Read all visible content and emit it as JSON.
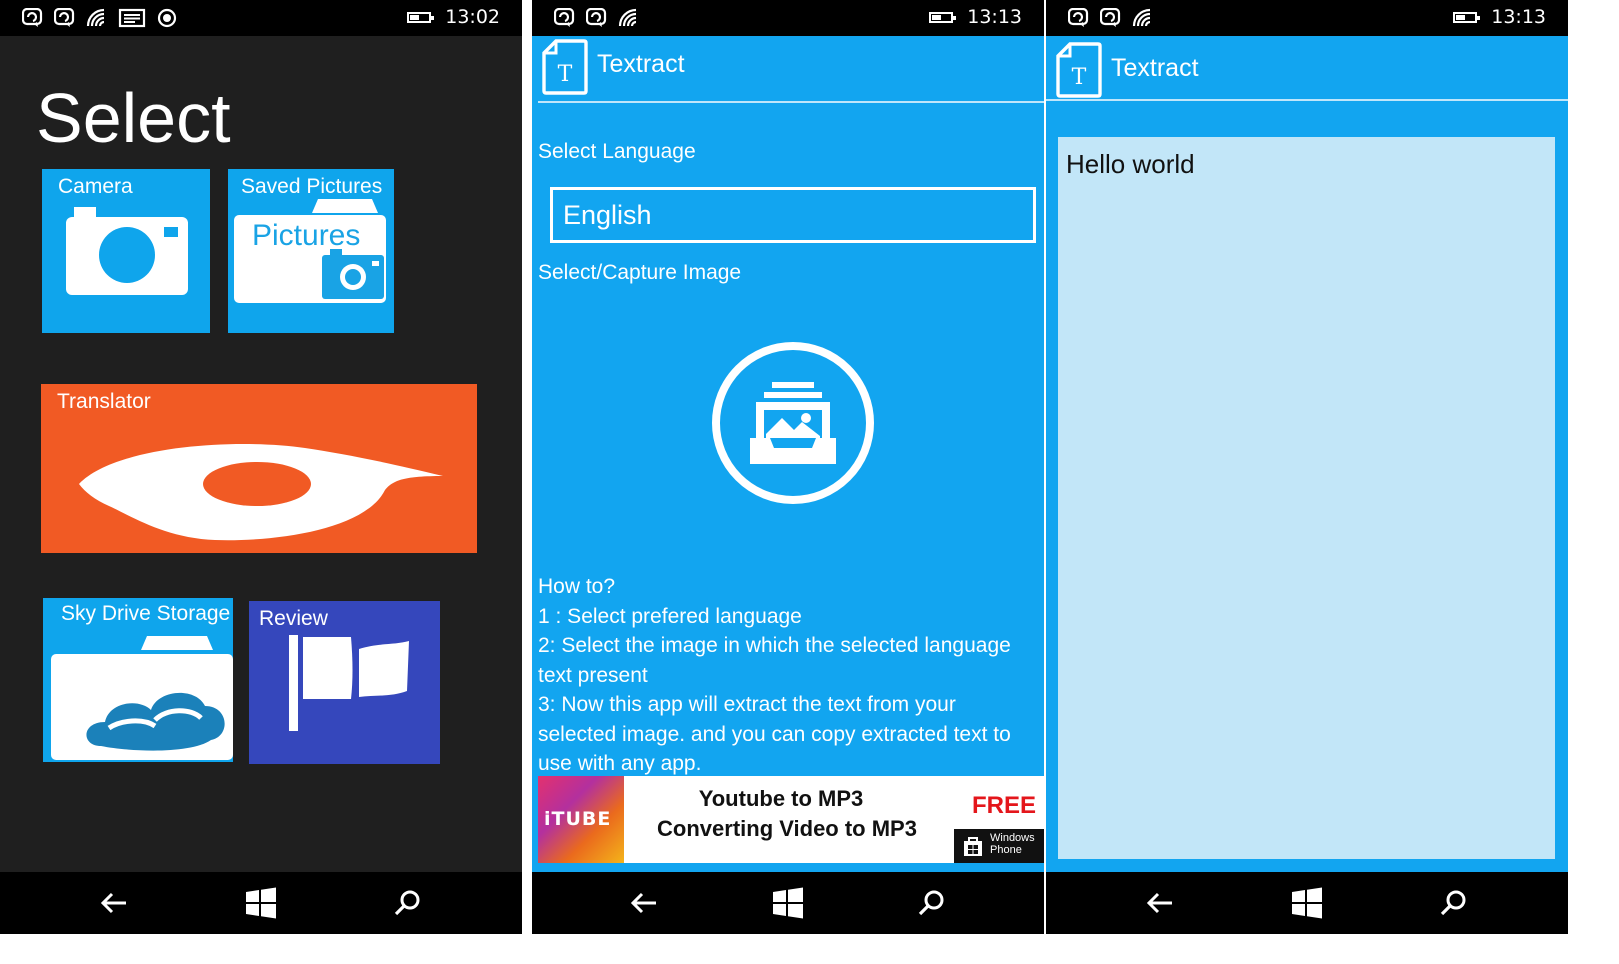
{
  "colors": {
    "accent": "#12a5f0",
    "tile_blue": "#0fa5ec",
    "tile_orange": "#f15a24",
    "tile_indigo": "#3547bc",
    "dark_bg": "#1f1f1f",
    "textbox_bg": "#c2e6f8",
    "ad_free": "#e4161b"
  },
  "screens": [
    {
      "status": {
        "time": "13:02",
        "icons": [
          "notification-icon",
          "notification-icon",
          "wifi-icon",
          "message-icon",
          "location-icon"
        ]
      },
      "title": "Select",
      "tiles": [
        {
          "label": "Camera",
          "icon": "camera-icon"
        },
        {
          "label": "Saved Pictures",
          "icon": "pictures-icon",
          "inner_text": "Pictures"
        },
        {
          "label": "Translator",
          "icon": "translator-icon"
        },
        {
          "label": "Sky Drive Storage",
          "icon": "skydrive-icon"
        },
        {
          "label": "Review",
          "icon": "flag-icon"
        }
      ]
    },
    {
      "status": {
        "time": "13:13",
        "icons": [
          "notification-icon",
          "notification-icon",
          "wifi-icon"
        ]
      },
      "app_name": "Textract",
      "select_language_label": "Select Language",
      "language_value": "English",
      "select_image_label": "Select/Capture Image",
      "howto": [
        "How to?",
        "1 : Select prefered language",
        "2: Select the image in which the selected language text present",
        "3: Now this app will extract the text from your selected image. and you can copy extracted text to use with any app."
      ],
      "ad": {
        "brand": "iTUBE",
        "line1": "Youtube to MP3",
        "line2": "Converting Video to MP3",
        "free": "FREE",
        "store_line1": "Windows",
        "store_line2": "Phone"
      }
    },
    {
      "status": {
        "time": "13:13",
        "icons": [
          "notification-icon",
          "notification-icon",
          "wifi-icon"
        ]
      },
      "app_name": "Textract",
      "extracted_text": "Hello world"
    }
  ],
  "nav_icons": [
    "back-icon",
    "windows-start-icon",
    "search-icon"
  ],
  "battery_level": 0.45
}
